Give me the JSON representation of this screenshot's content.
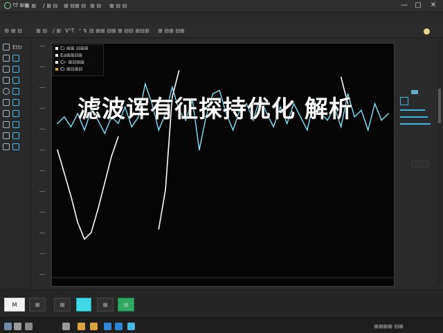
{
  "window": {
    "menu": [
      {
        "label": "ᗢ ⊞⊞",
        "icon": "app-icon"
      },
      {
        "label": "⊟ ⊞",
        "icon": "file-icon"
      },
      {
        "label": "∕ ⊞ ⊟",
        "icon": "edit-icon"
      },
      {
        "label": "⊞ ⊟⊞ ⊟",
        "icon": "view-icon"
      },
      {
        "label": "⊞ ⊟",
        "icon": "tools-icon"
      },
      {
        "label": "⊞ ⊟ ⊟",
        "icon": "help-icon"
      }
    ],
    "controls": {
      "min": "—",
      "max": "□",
      "close": "✕"
    }
  },
  "toolbar": {
    "items": [
      "⚙ ⊞ ⊟",
      "⊞ ⊟",
      "∕ ⊞",
      "V ⊟⊞",
      "⊞ ⊟⊟ ⊞⊟⊞",
      "⊞ ⊟⊞ ⊟⊞",
      "⊞ ⊟⊞"
    ],
    "labels_raw": [
      "",
      "",
      "VᐩT",
      "ᐩ ↯ ⊟ ⊞⊞ ⊟⊞",
      "",
      "",
      ""
    ]
  },
  "sidebar": {
    "items": [
      {
        "label": "Ettr",
        "icon": "pen-icon"
      },
      {
        "label": "",
        "icon": "brush-icon"
      },
      {
        "label": "",
        "icon": "pencil-icon"
      },
      {
        "label": "",
        "icon": "shape-icon"
      },
      {
        "label": "",
        "icon": "circle-icon"
      },
      {
        "label": "",
        "icon": "node-icon"
      },
      {
        "label": "",
        "icon": "layer-icon"
      },
      {
        "label": "",
        "icon": "marker-icon"
      },
      {
        "label": "",
        "icon": "triangle-icon"
      },
      {
        "label": "",
        "icon": "link-icon"
      }
    ]
  },
  "y_axis": {
    "ticks": [
      "",
      "",
      "",
      "",
      "",
      "",
      "",
      "",
      "",
      "",
      "",
      ""
    ]
  },
  "legend": {
    "entries": [
      {
        "label": "Cı ⊞⊞ ⊟⊞⊞",
        "color": "#ffffff"
      },
      {
        "label": "Ea⊞⊞⊟⊞",
        "color": "#ffffff"
      },
      {
        "label": "Cı- ⊞⊟⊞⊞",
        "color": "#ffffff"
      },
      {
        "label": "Cı ⊞⊟⊞⊟",
        "color": "#d7a84e"
      },
      {
        "label": "Cı ⊟⊞⊞ ⊞⊞",
        "color": "#ffffff"
      }
    ]
  },
  "overlay": {
    "title": "滤波诨有征探持优化 解析"
  },
  "right_panel": {
    "header": "",
    "items": [
      "",
      "",
      "",
      ""
    ]
  },
  "bottom_controls": {
    "buttons": [
      {
        "label": "M",
        "style": "light"
      },
      {
        "label": "⊞",
        "style": "dark"
      },
      {
        "label": "⊞",
        "style": "dark"
      },
      {
        "label": "",
        "style": "cyan"
      },
      {
        "label": "⊞",
        "style": "dark"
      },
      {
        "label": "⊞",
        "style": "green"
      }
    ]
  },
  "taskbar": {
    "time": "⊞⊞⊞⊞ ⊟⊞",
    "date": ""
  },
  "colors": {
    "cyan": "#7fe7ff",
    "white": "#ffffff",
    "accent": "#3fb5df",
    "yellow": "#e6d58a"
  },
  "chart_data": {
    "type": "line",
    "title": "",
    "xlabel": "",
    "ylabel": "",
    "grid": false,
    "legend_position": "top-left",
    "x": [
      0,
      10,
      20,
      30,
      40,
      50,
      60,
      70,
      80,
      90,
      100,
      110,
      120,
      130,
      140,
      150,
      160,
      170,
      180,
      190,
      200,
      210,
      220,
      230,
      240,
      250,
      260,
      270,
      280,
      290,
      300,
      310,
      320,
      330,
      340,
      350,
      360,
      370,
      380,
      390,
      400,
      410,
      420,
      430,
      440,
      450,
      460,
      470,
      480,
      490
    ],
    "series": [
      {
        "name": "",
        "color": "#7fe7ff",
        "values": [
          0,
          2,
          -1,
          3,
          -2,
          4,
          1,
          -3,
          2,
          0,
          5,
          -1,
          2,
          12,
          6,
          -2,
          3,
          11,
          4,
          1,
          7,
          -8,
          2,
          9,
          10,
          3,
          -2,
          4,
          6,
          1,
          8,
          3,
          -1,
          5,
          0,
          6,
          2,
          -2,
          7,
          3,
          1,
          5,
          -1,
          9,
          2,
          4,
          -2,
          6,
          1,
          3
        ]
      },
      {
        "name": "",
        "color": "#ffffff",
        "values": [
          -8,
          -15,
          -22,
          -30,
          -35,
          -33,
          -26,
          -18,
          -10,
          -4,
          null,
          null,
          null,
          null,
          null,
          -32,
          -20,
          8,
          16,
          null,
          null,
          null,
          null,
          null,
          null,
          null,
          null,
          null,
          null,
          null,
          null,
          null,
          null,
          null,
          null,
          null,
          null,
          null,
          null,
          null,
          null,
          null,
          14,
          6,
          null,
          null,
          null,
          null,
          null,
          null
        ]
      }
    ],
    "ylim": [
      -45,
      20
    ]
  }
}
